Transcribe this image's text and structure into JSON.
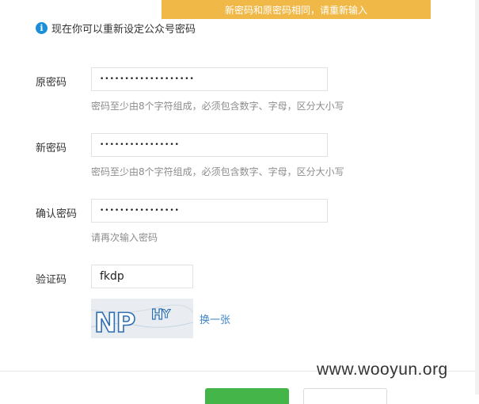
{
  "toast": {
    "message": "新密码和原密码相同，请重新输入"
  },
  "tip": {
    "icon": "info-icon",
    "text": "现在你可以重新设定公众号密码"
  },
  "form": {
    "old_password": {
      "label": "原密码",
      "value": "•••••••••••••••••••",
      "hint": "密码至少由8个字符组成，必须包含数字、字母，区分大小写"
    },
    "new_password": {
      "label": "新密码",
      "value": "••••••••••••••••",
      "hint": "密码至少由8个字符组成，必须包含数字、字母，区分大小写"
    },
    "confirm_password": {
      "label": "确认密码",
      "value": "••••••••••••••••",
      "hint": "请再次输入密码"
    },
    "captcha": {
      "label": "验证码",
      "value": "fkdp",
      "image_text": "NPHY",
      "refresh_label": "换一张"
    }
  },
  "watermark": "www.wooyun.org",
  "colors": {
    "toast": "#f0b847",
    "info_icon": "#1a8ed8",
    "link": "#3f86c9",
    "confirm_button": "#44b549"
  }
}
